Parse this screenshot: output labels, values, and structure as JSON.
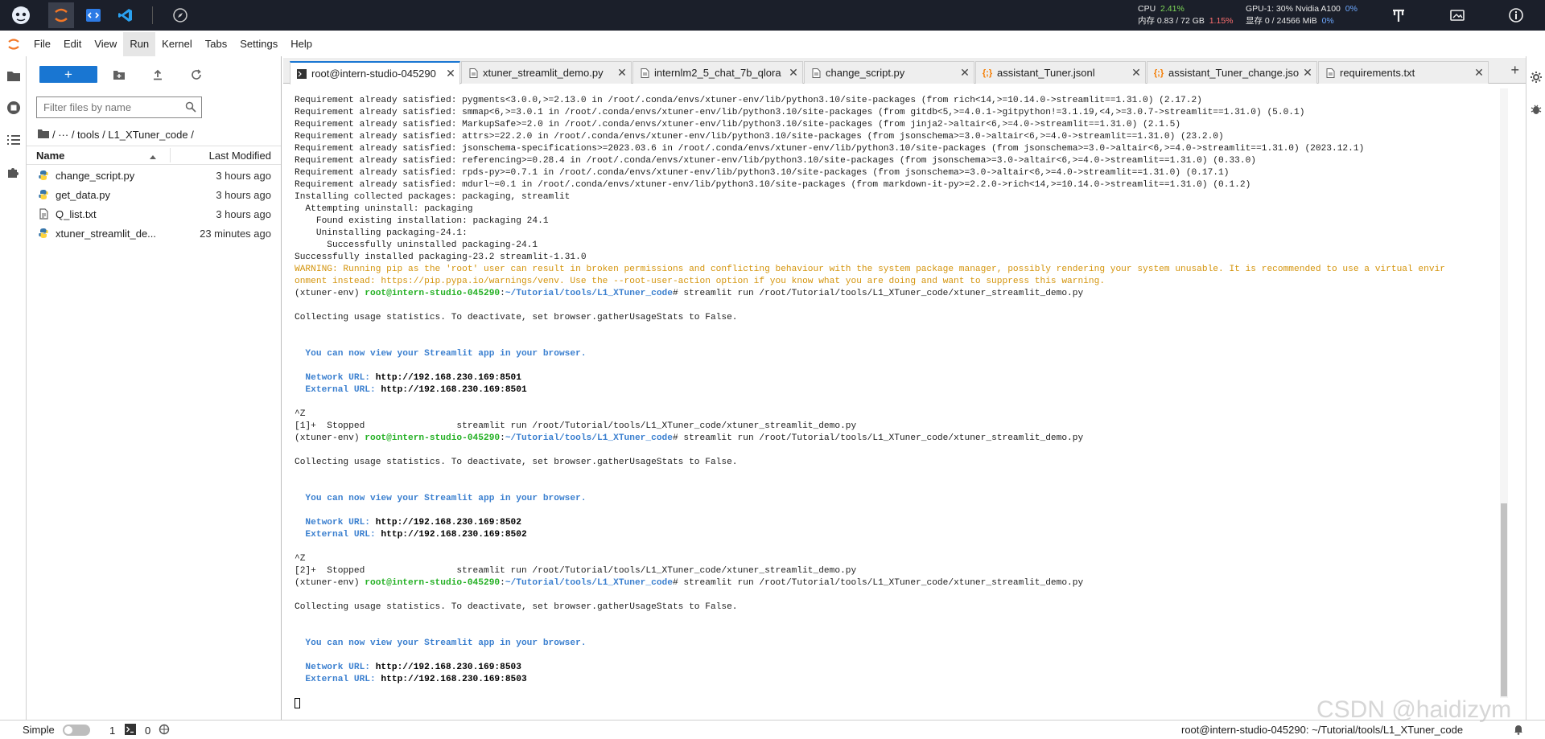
{
  "topbar": {
    "cpu_label": "CPU",
    "cpu_value": "2.41%",
    "mem_label": "内存 0.83 / 72 GB",
    "mem_value": "1.15%",
    "gpu_label": "GPU-1: 30% Nvidia A100",
    "gpu_value": "0%",
    "vram_label": "显存 0 / 24566 MiB",
    "vram_value": "0%"
  },
  "menu": [
    "File",
    "Edit",
    "View",
    "Run",
    "Kernel",
    "Tabs",
    "Settings",
    "Help"
  ],
  "filebrowser": {
    "new_label": "+",
    "filter_placeholder": "Filter files by name",
    "crumbs": "/   ···   / tools / L1_XTuner_code /",
    "col_name": "Name",
    "col_modified": "Last Modified",
    "files": [
      {
        "name": "change_script.py",
        "modified": "3 hours ago",
        "type": "python"
      },
      {
        "name": "get_data.py",
        "modified": "3 hours ago",
        "type": "python"
      },
      {
        "name": "Q_list.txt",
        "modified": "3 hours ago",
        "type": "text"
      },
      {
        "name": "xtuner_streamlit_de...",
        "modified": "23 minutes ago",
        "type": "python"
      }
    ]
  },
  "tabs": [
    {
      "label": "root@intern-studio-045290",
      "icon": "terminal-icon"
    },
    {
      "label": "xtuner_streamlit_demo.py",
      "icon": "file-icon"
    },
    {
      "label": "internlm2_5_chat_7b_qlora",
      "icon": "file-icon"
    },
    {
      "label": "change_script.py",
      "icon": "file-icon"
    },
    {
      "label": "assistant_Tuner.jsonl",
      "icon": "json-icon"
    },
    {
      "label": "assistant_Tuner_change.jsonl",
      "icon": "json-icon"
    },
    {
      "label": "requirements.txt",
      "icon": "file-icon"
    }
  ],
  "terminal": {
    "lines": [
      {
        "t": "Requirement already satisfied: pygments<3.0.0,>=2.13.0 in /root/.conda/envs/xtuner-env/lib/python3.10/site-packages (from rich<14,>=10.14.0->streamlit==1.31.0) (2.17.2)"
      },
      {
        "t": "Requirement already satisfied: smmap<6,>=3.0.1 in /root/.conda/envs/xtuner-env/lib/python3.10/site-packages (from gitdb<5,>=4.0.1->gitpython!=3.1.19,<4,>=3.0.7->streamlit==1.31.0) (5.0.1)"
      },
      {
        "t": "Requirement already satisfied: MarkupSafe>=2.0 in /root/.conda/envs/xtuner-env/lib/python3.10/site-packages (from jinja2->altair<6,>=4.0->streamlit==1.31.0) (2.1.5)"
      },
      {
        "t": "Requirement already satisfied: attrs>=22.2.0 in /root/.conda/envs/xtuner-env/lib/python3.10/site-packages (from jsonschema>=3.0->altair<6,>=4.0->streamlit==1.31.0) (23.2.0)"
      },
      {
        "t": "Requirement already satisfied: jsonschema-specifications>=2023.03.6 in /root/.conda/envs/xtuner-env/lib/python3.10/site-packages (from jsonschema>=3.0->altair<6,>=4.0->streamlit==1.31.0) (2023.12.1)"
      },
      {
        "t": "Requirement already satisfied: referencing>=0.28.4 in /root/.conda/envs/xtuner-env/lib/python3.10/site-packages (from jsonschema>=3.0->altair<6,>=4.0->streamlit==1.31.0) (0.33.0)"
      },
      {
        "t": "Requirement already satisfied: rpds-py>=0.7.1 in /root/.conda/envs/xtuner-env/lib/python3.10/site-packages (from jsonschema>=3.0->altair<6,>=4.0->streamlit==1.31.0) (0.17.1)"
      },
      {
        "t": "Requirement already satisfied: mdurl~=0.1 in /root/.conda/envs/xtuner-env/lib/python3.10/site-packages (from markdown-it-py>=2.2.0->rich<14,>=10.14.0->streamlit==1.31.0) (0.1.2)"
      },
      {
        "t": "Installing collected packages: packaging, streamlit"
      },
      {
        "t": "  Attempting uninstall: packaging"
      },
      {
        "t": "    Found existing installation: packaging 24.1"
      },
      {
        "t": "    Uninstalling packaging-24.1:"
      },
      {
        "t": "      Successfully uninstalled packaging-24.1"
      },
      {
        "t": "Successfully installed packaging-23.2 streamlit-1.31.0"
      },
      {
        "t": "WARNING: Running pip as the 'root' user can result in broken permissions and conflicting behaviour with the system package manager, possibly rendering your system unusable. It is recommended to use a virtual envir",
        "c": "warn"
      },
      {
        "t": "onment instead: https://pip.pypa.io/warnings/venv. Use the --root-user-action option if you know what you are doing and want to suppress this warning.",
        "c": "warn"
      },
      {
        "prompt": true,
        "env": "(xtuner-env) ",
        "user": "root@intern-studio-045290",
        "colon": ":",
        "path": "~/Tutorial/tools/L1_XTuner_code",
        "cmd": "# streamlit run /root/Tutorial/tools/L1_XTuner_code/xtuner_streamlit_demo.py"
      },
      {
        "t": ""
      },
      {
        "t": "Collecting usage statistics. To deactivate, set browser.gatherUsageStats to False."
      },
      {
        "t": ""
      },
      {
        "t": ""
      },
      {
        "t": "  You can now view your Streamlit app in your browser.",
        "c": "sblue"
      },
      {
        "t": ""
      },
      {
        "url": true,
        "label": "  Network URL: ",
        "value": "http://192.168.230.169:8501"
      },
      {
        "url": true,
        "label": "  External URL: ",
        "value": "http://192.168.230.169:8501"
      },
      {
        "t": ""
      },
      {
        "t": "^Z"
      },
      {
        "t": "[1]+  Stopped                 streamlit run /root/Tutorial/tools/L1_XTuner_code/xtuner_streamlit_demo.py"
      },
      {
        "prompt": true,
        "env": "(xtuner-env) ",
        "user": "root@intern-studio-045290",
        "colon": ":",
        "path": "~/Tutorial/tools/L1_XTuner_code",
        "cmd": "# streamlit run /root/Tutorial/tools/L1_XTuner_code/xtuner_streamlit_demo.py"
      },
      {
        "t": ""
      },
      {
        "t": "Collecting usage statistics. To deactivate, set browser.gatherUsageStats to False."
      },
      {
        "t": ""
      },
      {
        "t": ""
      },
      {
        "t": "  You can now view your Streamlit app in your browser.",
        "c": "sblue"
      },
      {
        "t": ""
      },
      {
        "url": true,
        "label": "  Network URL: ",
        "value": "http://192.168.230.169:8502"
      },
      {
        "url": true,
        "label": "  External URL: ",
        "value": "http://192.168.230.169:8502"
      },
      {
        "t": ""
      },
      {
        "t": "^Z"
      },
      {
        "t": "[2]+  Stopped                 streamlit run /root/Tutorial/tools/L1_XTuner_code/xtuner_streamlit_demo.py"
      },
      {
        "prompt": true,
        "env": "(xtuner-env) ",
        "user": "root@intern-studio-045290",
        "colon": ":",
        "path": "~/Tutorial/tools/L1_XTuner_code",
        "cmd": "# streamlit run /root/Tutorial/tools/L1_XTuner_code/xtuner_streamlit_demo.py"
      },
      {
        "t": ""
      },
      {
        "t": "Collecting usage statistics. To deactivate, set browser.gatherUsageStats to False."
      },
      {
        "t": ""
      },
      {
        "t": ""
      },
      {
        "t": "  You can now view your Streamlit app in your browser.",
        "c": "sblue"
      },
      {
        "t": ""
      },
      {
        "url": true,
        "label": "  Network URL: ",
        "value": "http://192.168.230.169:8503"
      },
      {
        "url": true,
        "label": "  External URL: ",
        "value": "http://192.168.230.169:8503"
      },
      {
        "t": ""
      },
      {
        "cursor": true
      }
    ]
  },
  "statusbar": {
    "mode_label": "Simple",
    "count_1": "1",
    "count_2": "0",
    "right_text": "root@intern-studio-045290: ~/Tutorial/tools/L1_XTuner_code"
  },
  "watermark": "CSDN @haidizym",
  "colors": {
    "accent": "#1976d2",
    "prompt_user": "#24b024",
    "prompt_path": "#3a7fcf",
    "warning": "#d4940c",
    "topbar_bg": "#1b1f2a"
  }
}
